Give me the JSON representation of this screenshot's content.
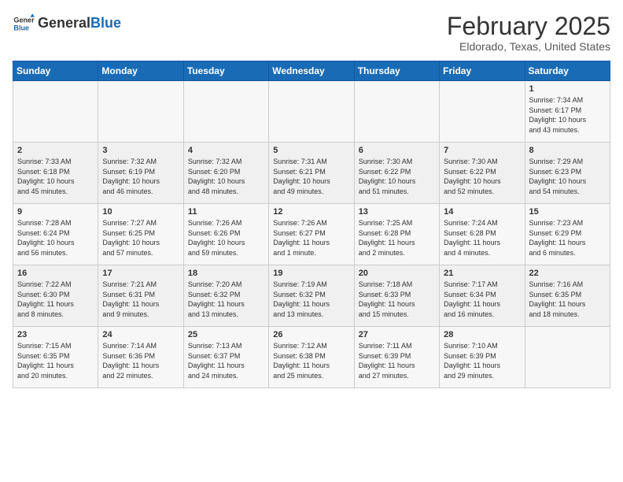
{
  "header": {
    "logo": {
      "general": "General",
      "blue": "Blue"
    },
    "title": "February 2025",
    "subtitle": "Eldorado, Texas, United States"
  },
  "weekdays": [
    "Sunday",
    "Monday",
    "Tuesday",
    "Wednesday",
    "Thursday",
    "Friday",
    "Saturday"
  ],
  "weeks": [
    [
      {
        "day": "",
        "info": ""
      },
      {
        "day": "",
        "info": ""
      },
      {
        "day": "",
        "info": ""
      },
      {
        "day": "",
        "info": ""
      },
      {
        "day": "",
        "info": ""
      },
      {
        "day": "",
        "info": ""
      },
      {
        "day": "1",
        "info": "Sunrise: 7:34 AM\nSunset: 6:17 PM\nDaylight: 10 hours\nand 43 minutes."
      }
    ],
    [
      {
        "day": "2",
        "info": "Sunrise: 7:33 AM\nSunset: 6:18 PM\nDaylight: 10 hours\nand 45 minutes."
      },
      {
        "day": "3",
        "info": "Sunrise: 7:32 AM\nSunset: 6:19 PM\nDaylight: 10 hours\nand 46 minutes."
      },
      {
        "day": "4",
        "info": "Sunrise: 7:32 AM\nSunset: 6:20 PM\nDaylight: 10 hours\nand 48 minutes."
      },
      {
        "day": "5",
        "info": "Sunrise: 7:31 AM\nSunset: 6:21 PM\nDaylight: 10 hours\nand 49 minutes."
      },
      {
        "day": "6",
        "info": "Sunrise: 7:30 AM\nSunset: 6:22 PM\nDaylight: 10 hours\nand 51 minutes."
      },
      {
        "day": "7",
        "info": "Sunrise: 7:30 AM\nSunset: 6:22 PM\nDaylight: 10 hours\nand 52 minutes."
      },
      {
        "day": "8",
        "info": "Sunrise: 7:29 AM\nSunset: 6:23 PM\nDaylight: 10 hours\nand 54 minutes."
      }
    ],
    [
      {
        "day": "9",
        "info": "Sunrise: 7:28 AM\nSunset: 6:24 PM\nDaylight: 10 hours\nand 56 minutes."
      },
      {
        "day": "10",
        "info": "Sunrise: 7:27 AM\nSunset: 6:25 PM\nDaylight: 10 hours\nand 57 minutes."
      },
      {
        "day": "11",
        "info": "Sunrise: 7:26 AM\nSunset: 6:26 PM\nDaylight: 10 hours\nand 59 minutes."
      },
      {
        "day": "12",
        "info": "Sunrise: 7:26 AM\nSunset: 6:27 PM\nDaylight: 11 hours\nand 1 minute."
      },
      {
        "day": "13",
        "info": "Sunrise: 7:25 AM\nSunset: 6:28 PM\nDaylight: 11 hours\nand 2 minutes."
      },
      {
        "day": "14",
        "info": "Sunrise: 7:24 AM\nSunset: 6:28 PM\nDaylight: 11 hours\nand 4 minutes."
      },
      {
        "day": "15",
        "info": "Sunrise: 7:23 AM\nSunset: 6:29 PM\nDaylight: 11 hours\nand 6 minutes."
      }
    ],
    [
      {
        "day": "16",
        "info": "Sunrise: 7:22 AM\nSunset: 6:30 PM\nDaylight: 11 hours\nand 8 minutes."
      },
      {
        "day": "17",
        "info": "Sunrise: 7:21 AM\nSunset: 6:31 PM\nDaylight: 11 hours\nand 9 minutes."
      },
      {
        "day": "18",
        "info": "Sunrise: 7:20 AM\nSunset: 6:32 PM\nDaylight: 11 hours\nand 13 minutes."
      },
      {
        "day": "19",
        "info": "Sunrise: 7:19 AM\nSunset: 6:32 PM\nDaylight: 11 hours\nand 13 minutes."
      },
      {
        "day": "20",
        "info": "Sunrise: 7:18 AM\nSunset: 6:33 PM\nDaylight: 11 hours\nand 15 minutes."
      },
      {
        "day": "21",
        "info": "Sunrise: 7:17 AM\nSunset: 6:34 PM\nDaylight: 11 hours\nand 16 minutes."
      },
      {
        "day": "22",
        "info": "Sunrise: 7:16 AM\nSunset: 6:35 PM\nDaylight: 11 hours\nand 18 minutes."
      }
    ],
    [
      {
        "day": "23",
        "info": "Sunrise: 7:15 AM\nSunset: 6:35 PM\nDaylight: 11 hours\nand 20 minutes."
      },
      {
        "day": "24",
        "info": "Sunrise: 7:14 AM\nSunset: 6:36 PM\nDaylight: 11 hours\nand 22 minutes."
      },
      {
        "day": "25",
        "info": "Sunrise: 7:13 AM\nSunset: 6:37 PM\nDaylight: 11 hours\nand 24 minutes."
      },
      {
        "day": "26",
        "info": "Sunrise: 7:12 AM\nSunset: 6:38 PM\nDaylight: 11 hours\nand 25 minutes."
      },
      {
        "day": "27",
        "info": "Sunrise: 7:11 AM\nSunset: 6:39 PM\nDaylight: 11 hours\nand 27 minutes."
      },
      {
        "day": "28",
        "info": "Sunrise: 7:10 AM\nSunset: 6:39 PM\nDaylight: 11 hours\nand 29 minutes."
      },
      {
        "day": "",
        "info": ""
      }
    ]
  ]
}
